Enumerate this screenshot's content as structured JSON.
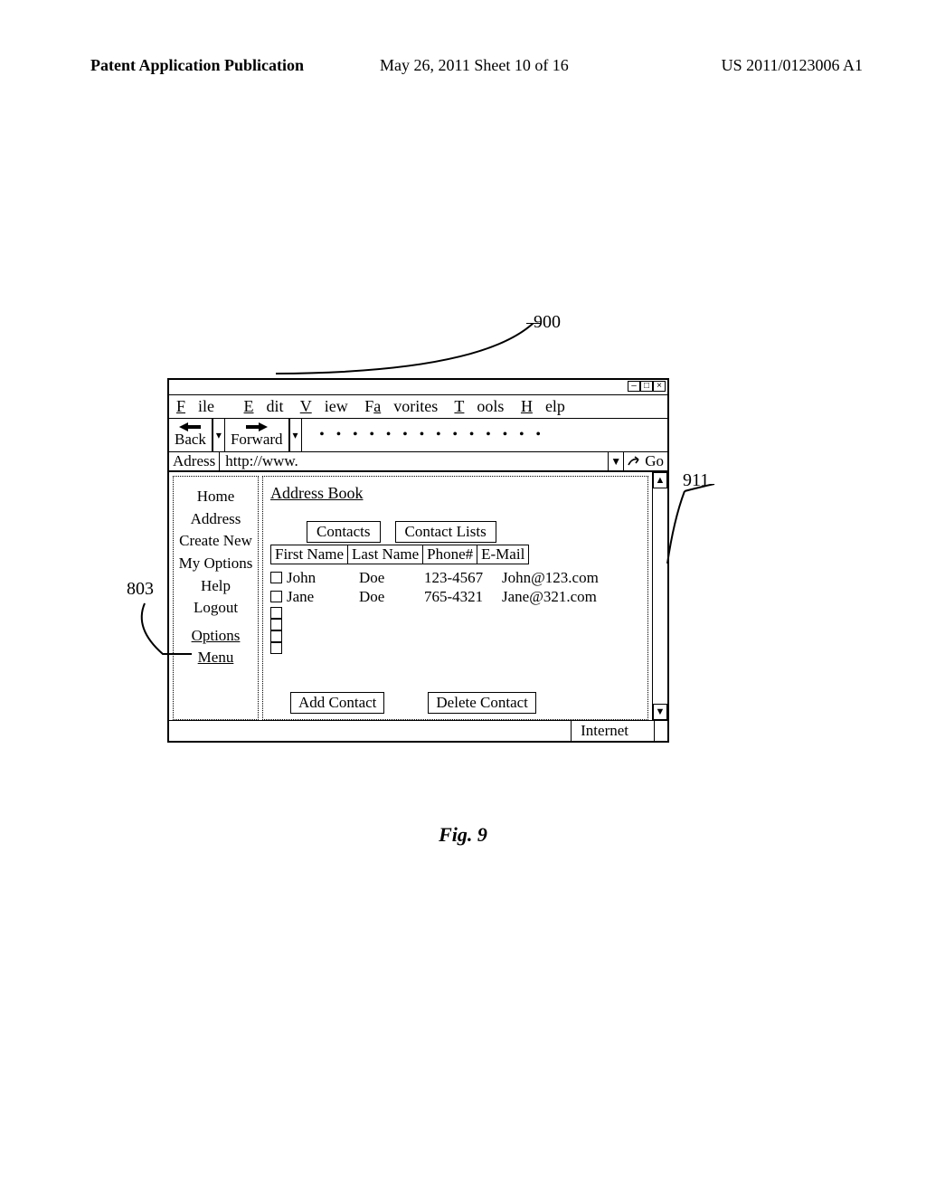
{
  "header": {
    "left": "Patent Application Publication",
    "center": "May 26, 2011  Sheet 10 of 16",
    "right": "US 2011/0123006 A1"
  },
  "refs": {
    "r900": "900",
    "r911": "911",
    "r803": "803"
  },
  "browser": {
    "menu": {
      "file": "File",
      "edit": "Edit",
      "view": "View",
      "fav": "Favorites",
      "tools": "Tools",
      "help": "Help"
    },
    "toolbar": {
      "back": "Back",
      "forward": "Forward",
      "dots": "• • • • • • • • • • • • • •"
    },
    "address": {
      "label": "Adress",
      "url": "http://www.",
      "go": "Go"
    },
    "status": {
      "zone": "Internet"
    }
  },
  "sidebar": {
    "items": [
      {
        "label": "Home"
      },
      {
        "label": "Address"
      },
      {
        "label": "Create New"
      },
      {
        "label": "My Options"
      },
      {
        "label": "Help"
      },
      {
        "label": "Logout"
      }
    ],
    "options_heading_line1": "Options",
    "options_heading_line2": "Menu"
  },
  "main": {
    "title": "Address Book",
    "tabs": {
      "contacts": "Contacts",
      "lists": "Contact Lists"
    },
    "columns": {
      "first": "First Name",
      "last": "Last Name",
      "phone": "Phone#",
      "email": "E-Mail"
    },
    "rows": [
      {
        "first": "John",
        "last": "Doe",
        "phone": "123-4567",
        "email": "John@123.com"
      },
      {
        "first": "Jane",
        "last": "Doe",
        "phone": "765-4321",
        "email": "Jane@321.com"
      }
    ],
    "extra_checkbox_count": 4,
    "actions": {
      "add": "Add Contact",
      "del": "Delete Contact"
    }
  },
  "caption": "Fig. 9"
}
